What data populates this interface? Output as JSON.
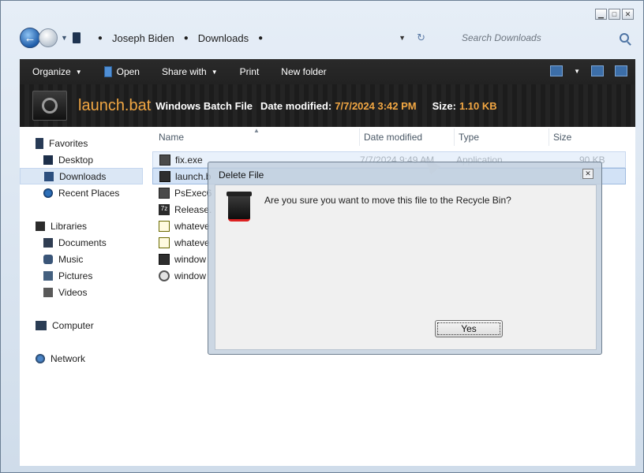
{
  "window": {
    "controls": [
      "▁",
      "□",
      "✕"
    ]
  },
  "address": {
    "back_label": "←",
    "crumbs": [
      "Joseph Biden",
      "Downloads"
    ],
    "search_placeholder": "Search Downloads"
  },
  "toolbar": {
    "organize": "Organize",
    "open": "Open",
    "share_with": "Share with",
    "print": "Print",
    "new_folder": "New folder"
  },
  "details": {
    "file_name": "launch.bat",
    "file_type": "Windows Batch File",
    "date_label": "Date modified:",
    "date_value": "7/7/2024 3:42 PM",
    "size_label": "Size:",
    "size_value": "1.10 KB"
  },
  "nav": {
    "favorites": "Favorites",
    "desktop": "Desktop",
    "downloads": "Downloads",
    "recent": "Recent Places",
    "libraries": "Libraries",
    "documents": "Documents",
    "music": "Music",
    "pictures": "Pictures",
    "videos": "Videos",
    "computer": "Computer",
    "network": "Network"
  },
  "columns": {
    "name": "Name",
    "date": "Date modified",
    "type": "Type",
    "size": "Size"
  },
  "files": [
    {
      "name": "fix.exe",
      "icon": "exe-icon",
      "date": "7/7/2024 9:49 AM",
      "type": "Application",
      "size": "90 KB"
    },
    {
      "name": "launch.b",
      "icon": "bat-icon",
      "date": "",
      "type": "",
      "size": "B"
    },
    {
      "name": "PsExec6",
      "icon": "exe-icon",
      "date": "",
      "type": "",
      "size": "B"
    },
    {
      "name": "Release.",
      "icon": "zip-icon",
      "date": "",
      "type": "",
      "size": "B"
    },
    {
      "name": "whateve",
      "icon": "txt-icon",
      "date": "",
      "type": "",
      "size": "B"
    },
    {
      "name": "whateve",
      "icon": "txt-icon",
      "date": "",
      "type": "",
      "size": "B"
    },
    {
      "name": "window",
      "icon": "bat-icon",
      "date": "",
      "type": "",
      "size": "B"
    },
    {
      "name": "window",
      "icon": "gear-file-icon",
      "date": "",
      "type": "",
      "size": "B"
    }
  ],
  "dialog": {
    "title": "Delete File",
    "close": "✕",
    "message": "Are you sure you want to move this file to the Recycle Bin?",
    "yes_label": "Yes"
  }
}
